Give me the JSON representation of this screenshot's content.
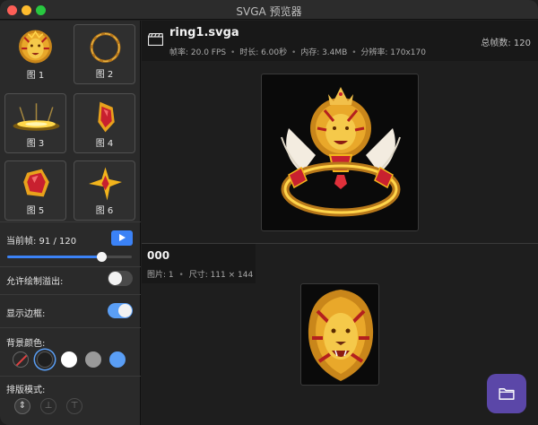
{
  "window": {
    "title": "SVGA 预览器"
  },
  "sidebar": {
    "thumbnails": [
      {
        "label": "图 1",
        "icon": "lion-head-icon"
      },
      {
        "label": "图 2",
        "icon": "gold-ring-icon"
      },
      {
        "label": "图 3",
        "icon": "gold-pedestal-icon"
      },
      {
        "label": "图 4",
        "icon": "red-gem-icon"
      },
      {
        "label": "图 5",
        "icon": "red-gem-icon"
      },
      {
        "label": "图 6",
        "icon": "gold-star-gem-icon"
      }
    ],
    "frame_label": "当前帧: 91 / 120",
    "frame_progress": 0.758,
    "overflow_label": "允许绘制溢出:",
    "overflow_enabled": false,
    "border_label": "显示边框:",
    "border_enabled": true,
    "bg_label": "背景颜色:",
    "bg_colors": [
      "none",
      "#1f1f1f",
      "#ffffff",
      "#9a9a9a",
      "#5a9ef5"
    ],
    "bg_selected": 1,
    "layout_label": "排版模式:",
    "layout_modes": [
      "center-align-icon",
      "bottom-align-icon",
      "top-align-icon"
    ],
    "layout_icons": [
      "⇕",
      "⊥",
      "⊤"
    ]
  },
  "main": {
    "file_name": "ring1.svga",
    "meta": {
      "fps": "帧率: 20.0 FPS",
      "duration": "时长: 6.00秒",
      "memory": "内存: 3.4MB",
      "resolution": "分辨率: 170x170",
      "separator": "•"
    },
    "total_frames": "总帧数: 120",
    "frame_name": "000",
    "frame_meta": {
      "images": "图片: 1",
      "size": "尺寸: 111 × 144"
    }
  },
  "colors": {
    "accent": "#3b82f6",
    "folder_button": "#5b47a8",
    "gold": "#f2b41c",
    "red_gem": "#c8202f"
  }
}
